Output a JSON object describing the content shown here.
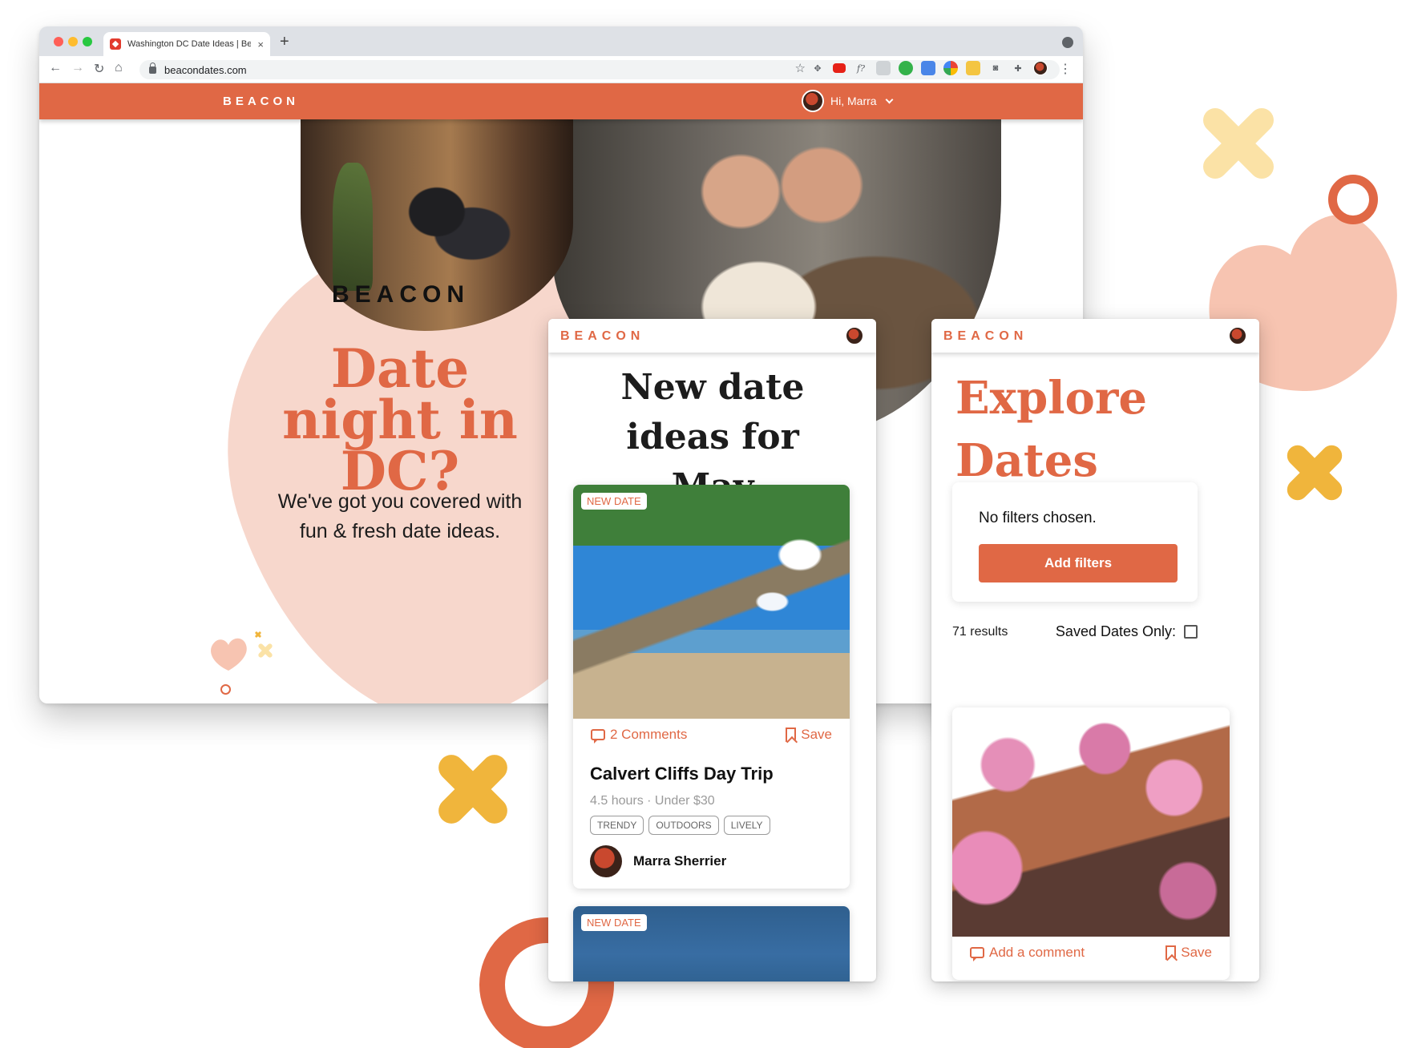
{
  "browser": {
    "tab_title": "Washington DC Date Ideas | Be",
    "url": "beacondates.com",
    "new_tab_symbol": "+",
    "close_symbol": "×"
  },
  "site": {
    "logo": "BEACON",
    "greeting": "Hi, Marra",
    "brand_color": "#e06845"
  },
  "hero": {
    "logo": "BEACON",
    "title": "Date night in DC?",
    "subtitle": "We've got you covered with fun & fresh date ideas."
  },
  "new_dates_panel": {
    "logo": "BEACON",
    "title": "New date ideas for May",
    "cards": [
      {
        "badge": "NEW DATE",
        "comments": "2 Comments",
        "save": "Save",
        "title": "Calvert Cliffs Day Trip",
        "meta": "4.5 hours · Under $30",
        "tags": [
          "TRENDY",
          "OUTDOORS",
          "LIVELY"
        ],
        "author": "Marra Sherrier"
      },
      {
        "badge": "NEW DATE"
      }
    ]
  },
  "explore_panel": {
    "logo": "BEACON",
    "title": "Explore Dates",
    "filter_status": "No filters chosen.",
    "add_filters_label": "Add filters",
    "results_count": "71 results",
    "saved_only_label": "Saved Dates Only:",
    "card": {
      "comment": "Add a comment",
      "save": "Save"
    }
  }
}
